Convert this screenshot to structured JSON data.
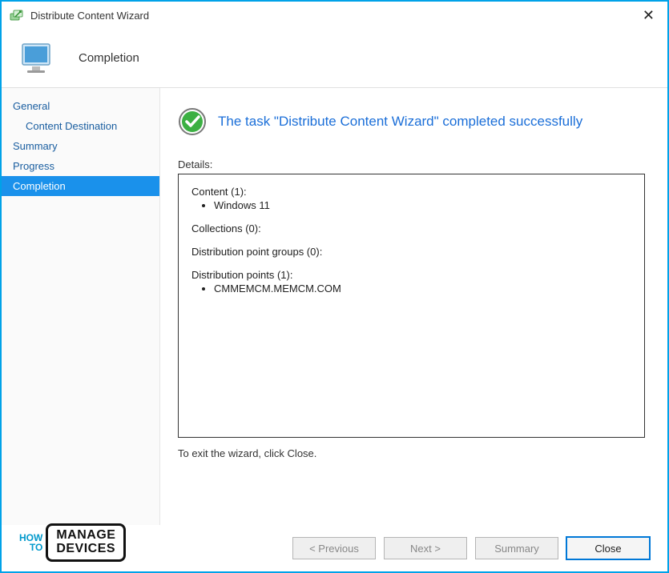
{
  "window": {
    "title": "Distribute Content Wizard",
    "heading": "Completion"
  },
  "sidebar": {
    "items": [
      {
        "label": "General",
        "indent": false,
        "active": false
      },
      {
        "label": "Content Destination",
        "indent": true,
        "active": false
      },
      {
        "label": "Summary",
        "indent": false,
        "active": false
      },
      {
        "label": "Progress",
        "indent": false,
        "active": false
      },
      {
        "label": "Completion",
        "indent": false,
        "active": true
      }
    ]
  },
  "content": {
    "success_message": "The task \"Distribute Content Wizard\" completed successfully",
    "details_label": "Details:",
    "details": {
      "content_label": "Content (1):",
      "content_items": [
        "Windows 11"
      ],
      "collections_label": "Collections (0):",
      "dpg_label": "Distribution point groups (0):",
      "dp_label": "Distribution points (1):",
      "dp_items": [
        "CMMEMCM.MEMCM.COM"
      ]
    },
    "exit_hint": "To exit the wizard, click Close."
  },
  "footer": {
    "previous": "< Previous",
    "next": "Next >",
    "summary": "Summary",
    "close": "Close"
  },
  "watermark": {
    "how": "HOW",
    "to": "TO",
    "line1": "MANAGE",
    "line2": "DEVICES"
  }
}
